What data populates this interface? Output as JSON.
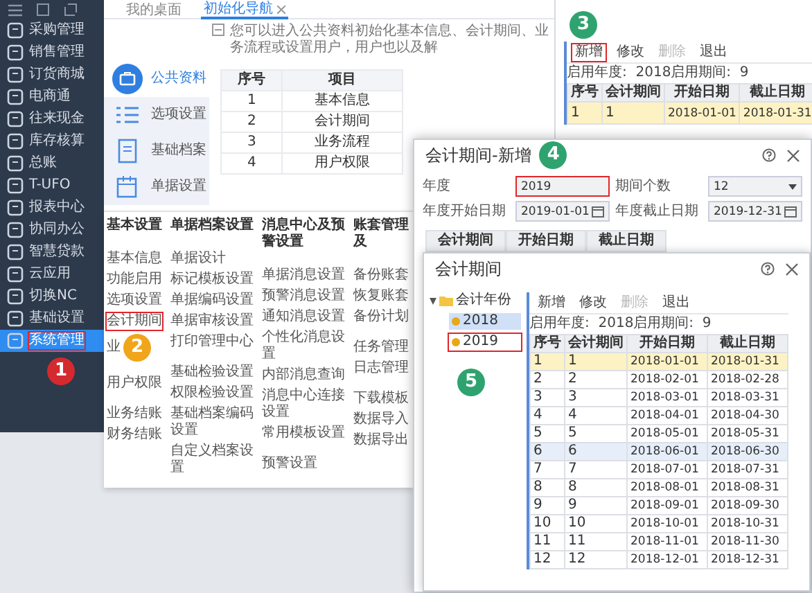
{
  "sidebar": {
    "items": [
      {
        "label": "采购管理",
        "selected": false,
        "highlighted": false
      },
      {
        "label": "销售管理",
        "selected": false,
        "highlighted": false
      },
      {
        "label": "订货商城",
        "selected": false,
        "highlighted": false
      },
      {
        "label": "电商通",
        "selected": false,
        "highlighted": false
      },
      {
        "label": "往来现金",
        "selected": false,
        "highlighted": false
      },
      {
        "label": "库存核算",
        "selected": false,
        "highlighted": false
      },
      {
        "label": "总账",
        "selected": false,
        "highlighted": false
      },
      {
        "label": "T-UFO",
        "selected": false,
        "highlighted": false
      },
      {
        "label": "报表中心",
        "selected": false,
        "highlighted": false
      },
      {
        "label": "协同办公",
        "selected": false,
        "highlighted": false
      },
      {
        "label": "智慧贷款",
        "selected": false,
        "highlighted": false
      },
      {
        "label": "云应用",
        "selected": false,
        "highlighted": false
      },
      {
        "label": "切换NC",
        "selected": false,
        "highlighted": false
      },
      {
        "label": "基础设置",
        "selected": false,
        "highlighted": false
      },
      {
        "label": "系统管理",
        "selected": true,
        "highlighted": true
      }
    ],
    "marker": {
      "label": "1",
      "color": "#d42a2f"
    }
  },
  "tabs": [
    {
      "label": "我的桌面",
      "selected": false,
      "closable": false
    },
    {
      "label": "初始化导航",
      "selected": true,
      "closable": true
    }
  ],
  "notice": "您可以进入公共资料初始化基本信息、会计期间、业务流程或设置用户，用户也以及解",
  "nav": [
    {
      "label": "公共资料",
      "selected": true
    },
    {
      "label": "选项设置",
      "selected": false
    },
    {
      "label": "基础档案",
      "selected": false
    },
    {
      "label": "单据设置",
      "selected": false
    }
  ],
  "table": {
    "columns": [
      "序号",
      "项目"
    ],
    "rows": [
      [
        "1",
        "基本信息"
      ],
      [
        "2",
        "会计期间"
      ],
      [
        "3",
        "业务流程"
      ],
      [
        "4",
        "用户权限"
      ]
    ]
  },
  "menu": {
    "columns": [
      {
        "heading": "基本设置",
        "groups": [
          [
            {
              "label": "基本信息",
              "highlighted": false
            },
            {
              "label": "功能启用",
              "highlighted": false
            },
            {
              "label": "选项设置",
              "highlighted": false
            },
            {
              "label": "会计期间",
              "highlighted": true
            },
            {
              "label": "业",
              "highlighted": false,
              "marker": {
                "label": "2",
                "color": "#f0a51a"
              }
            }
          ],
          [
            {
              "label": "用户权限",
              "highlighted": false
            }
          ],
          [
            {
              "label": "业务结账",
              "highlighted": false
            },
            {
              "label": "财务结账",
              "highlighted": false
            }
          ]
        ]
      },
      {
        "heading": "单据档案设置",
        "groups": [
          [
            {
              "label": "单据设计",
              "highlighted": false
            },
            {
              "label": "标记模板设置",
              "highlighted": false
            },
            {
              "label": "单据编码设置",
              "highlighted": false
            },
            {
              "label": "单据审核设置",
              "highlighted": false
            },
            {
              "label": "打印管理中心",
              "highlighted": false
            }
          ],
          [
            {
              "label": "基础检验设置",
              "highlighted": false
            },
            {
              "label": "权限检验设置",
              "highlighted": false
            },
            {
              "label": "基础档案编码设置",
              "highlighted": false
            },
            {
              "label": "自定义档案设置",
              "highlighted": false
            }
          ]
        ]
      },
      {
        "heading": "消息中心及预警设置",
        "groups": [
          [
            {
              "label": "单据消息设置",
              "highlighted": false
            },
            {
              "label": "预警消息设置",
              "highlighted": false
            },
            {
              "label": "通知消息设置",
              "highlighted": false
            },
            {
              "label": "个性化消息设置",
              "highlighted": false
            },
            {
              "label": "内部消息查询",
              "highlighted": false
            },
            {
              "label": "消息中心连接设置",
              "highlighted": false
            },
            {
              "label": "常用模板设置",
              "highlighted": false
            }
          ],
          [
            {
              "label": "预警设置",
              "highlighted": false
            }
          ]
        ]
      },
      {
        "heading": "账套管理及",
        "groups": [
          [
            {
              "label": "备份账套",
              "highlighted": false
            },
            {
              "label": "恢复账套",
              "highlighted": false
            },
            {
              "label": "备份计划",
              "highlighted": false
            }
          ],
          [
            {
              "label": "任务管理",
              "highlighted": false
            },
            {
              "label": "日志管理",
              "highlighted": false
            }
          ],
          [
            {
              "label": "下载模板",
              "highlighted": false
            },
            {
              "label": "数据导入",
              "highlighted": false
            },
            {
              "label": "数据导出",
              "highlighted": false
            }
          ]
        ]
      }
    ]
  },
  "period_panel": {
    "marker": {
      "label": "3",
      "color": "#2fa36f"
    },
    "toolbar": [
      {
        "label": "新增",
        "highlighted": true,
        "disabled": false
      },
      {
        "label": "修改",
        "highlighted": false,
        "disabled": false
      },
      {
        "label": "删除",
        "highlighted": false,
        "disabled": true
      },
      {
        "label": "退出",
        "highlighted": false,
        "disabled": false
      }
    ],
    "info": "启用年度:  2018启用期间:  9",
    "columns": [
      "序号",
      "会计期间",
      "开始日期",
      "截止日期"
    ],
    "rows": [
      {
        "cells": [
          "1",
          "1",
          "2018-01-01",
          "2018-01-31"
        ],
        "selected": true
      }
    ]
  },
  "dialog": {
    "title": "会计期间-新增",
    "marker": {
      "label": "4",
      "color": "#2fa36f"
    },
    "fields": [
      {
        "label": "年度",
        "value": "2019",
        "kind": "text",
        "highlighted": true
      },
      {
        "label": "期间个数",
        "value": "12",
        "kind": "select",
        "highlighted": false
      },
      {
        "label": "年度开始日期",
        "value": "2019-01-01",
        "kind": "date",
        "highlighted": false
      },
      {
        "label": "年度截止日期",
        "value": "2019-12-31",
        "kind": "date",
        "highlighted": false
      }
    ],
    "grid_columns": [
      "会计期间",
      "开始日期",
      "截止日期"
    ],
    "inner": {
      "title": "会计期间",
      "tree": [
        {
          "label": "会计年份",
          "expanded": true,
          "children": [
            {
              "label": "2018",
              "selected": true,
              "highlighted": false
            },
            {
              "label": "2019",
              "selected": false,
              "highlighted": true
            }
          ]
        }
      ],
      "marker": {
        "label": "5",
        "color": "#2fa36f"
      },
      "toolbar": [
        {
          "label": "新增",
          "disabled": false
        },
        {
          "label": "修改",
          "disabled": false
        },
        {
          "label": "删除",
          "disabled": true
        },
        {
          "label": "退出",
          "disabled": false
        }
      ],
      "info": "启用年度:  2018启用期间:  9",
      "columns": [
        "序号",
        "会计期间",
        "开始日期",
        "截止日期"
      ],
      "rows": [
        {
          "cells": [
            "1",
            "1",
            "2018-01-01",
            "2018-01-31"
          ],
          "selected": true,
          "hovered": false
        },
        {
          "cells": [
            "2",
            "2",
            "2018-02-01",
            "2018-02-28"
          ],
          "selected": false,
          "hovered": false
        },
        {
          "cells": [
            "3",
            "3",
            "2018-03-01",
            "2018-03-31"
          ],
          "selected": false,
          "hovered": false
        },
        {
          "cells": [
            "4",
            "4",
            "2018-04-01",
            "2018-04-30"
          ],
          "selected": false,
          "hovered": false
        },
        {
          "cells": [
            "5",
            "5",
            "2018-05-01",
            "2018-05-31"
          ],
          "selected": false,
          "hovered": false
        },
        {
          "cells": [
            "6",
            "6",
            "2018-06-01",
            "2018-06-30"
          ],
          "selected": false,
          "hovered": true
        },
        {
          "cells": [
            "7",
            "7",
            "2018-07-01",
            "2018-07-31"
          ],
          "selected": false,
          "hovered": false
        },
        {
          "cells": [
            "8",
            "8",
            "2018-08-01",
            "2018-08-31"
          ],
          "selected": false,
          "hovered": false
        },
        {
          "cells": [
            "9",
            "9",
            "2018-09-01",
            "2018-09-30"
          ],
          "selected": false,
          "hovered": false
        },
        {
          "cells": [
            "10",
            "10",
            "2018-10-01",
            "2018-10-31"
          ],
          "selected": false,
          "hovered": false
        },
        {
          "cells": [
            "11",
            "11",
            "2018-11-01",
            "2018-11-30"
          ],
          "selected": false,
          "hovered": false
        },
        {
          "cells": [
            "12",
            "12",
            "2018-12-01",
            "2018-12-31"
          ],
          "selected": false,
          "hovered": false
        }
      ]
    }
  }
}
